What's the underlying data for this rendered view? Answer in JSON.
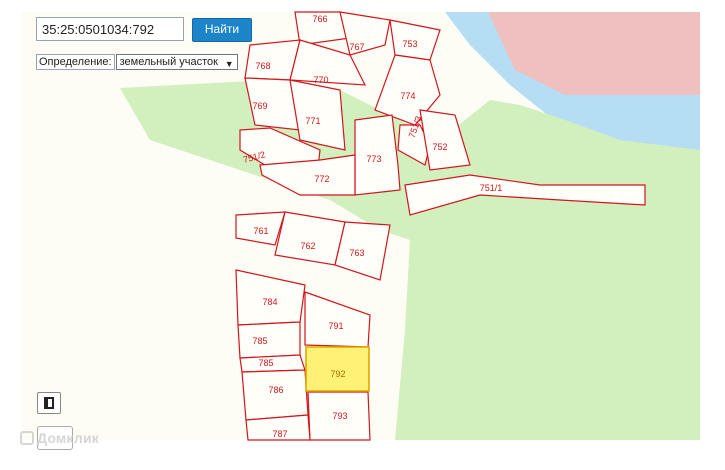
{
  "search": {
    "value": "35:25:0501034:792",
    "button_label": "Найти"
  },
  "definition": {
    "label": "Определение:",
    "selected": "земельный участок"
  },
  "watermark": "Домклик",
  "colors": {
    "parcel_border": "#d0161e",
    "selected_parcel_fill": "#fff176",
    "water": "#b5ddf3",
    "green": "#d2efbe",
    "restricted": "#f0c0c0",
    "background": "#fdfcf5"
  },
  "parcels": [
    "766",
    "767",
    "768",
    "753",
    "770",
    "769",
    "774",
    "771",
    "751/3",
    "752",
    "751/2",
    "773",
    "772",
    "751/1",
    "761",
    "762",
    "763",
    "784",
    "791",
    "785",
    "785",
    "792",
    "786",
    "793",
    "787"
  ],
  "selected_parcel": "792"
}
